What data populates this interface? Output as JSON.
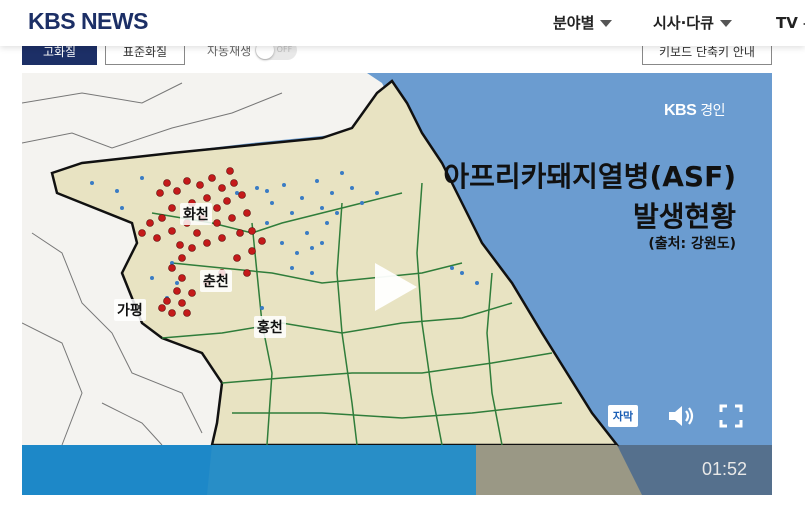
{
  "header": {
    "logo": "KBS NEWS",
    "nav": [
      {
        "label": "분야별"
      },
      {
        "label": "시사·다큐"
      },
      {
        "label": "TV 뉴"
      }
    ]
  },
  "toolbar": {
    "left_btn": "고화질",
    "right_btn": "키보드 단축키 안내",
    "quality_btn": "표준화질",
    "autoplay_label": "자동재생",
    "toggle_state": "OFF"
  },
  "video": {
    "watermark_brand": "KBS",
    "watermark_region": "경인",
    "title_line1": "아프리카돼지열병(ASF)",
    "title_line2": "발생현황",
    "source": "(출처: 강원도)",
    "map_labels": {
      "hwacheon": "화천",
      "chuncheon": "춘천",
      "gapyeong": "가평",
      "hongcheon": "홍천"
    },
    "caption_button": "자막",
    "time": "01:52",
    "progress": 0.605
  },
  "colors": {
    "brand_navy": "#1c2f66",
    "sea": "#6b9cd0",
    "land": "#e8e3c2",
    "outer_land": "#f4f3f0",
    "border_green": "#2f7d3a",
    "asf_red": "#c41a1a",
    "asf_blue": "#3a7cc4",
    "progress": "#148cd2"
  }
}
